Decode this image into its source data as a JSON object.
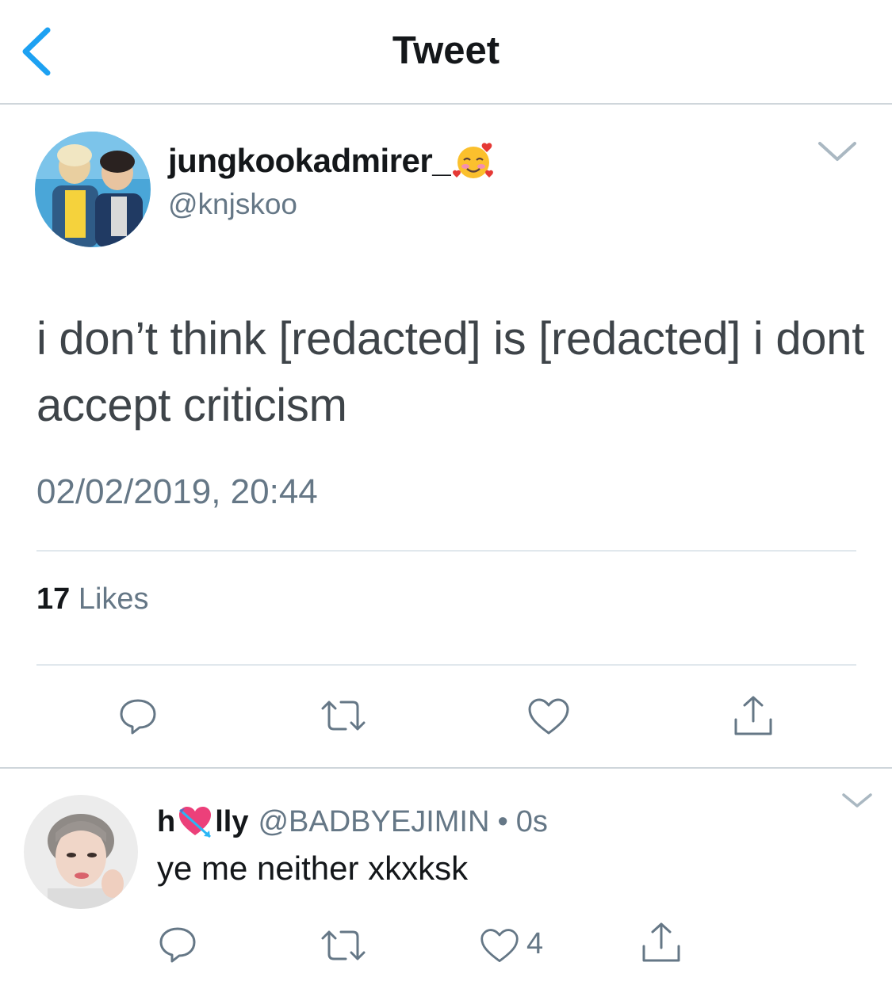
{
  "header": {
    "title": "Tweet",
    "back_icon": "chevron-left-icon"
  },
  "colors": {
    "accent": "#1da1f2",
    "text": "#14171a",
    "secondary": "#657786",
    "divider": "#e1e8ed"
  },
  "tweet": {
    "display_name": "jungkookadmirer_",
    "name_emoji": "smiling-face-with-hearts",
    "handle": "@knjskoo",
    "text": "i don’t think [redacted] is [redacted] i dont accept criticism",
    "timestamp": "02/02/2019, 20:44",
    "likes_count": "17",
    "likes_label": " Likes",
    "actions": [
      "reply-icon",
      "retweet-icon",
      "like-icon",
      "share-icon"
    ]
  },
  "reply": {
    "name_pre": "h",
    "name_emoji": "heart-with-arrow",
    "name_post": "lly",
    "handle": "@BADBYEJIMIN",
    "separator": "•",
    "time": "0s",
    "text": "ye me neither xkxksk",
    "like_count": "4"
  }
}
